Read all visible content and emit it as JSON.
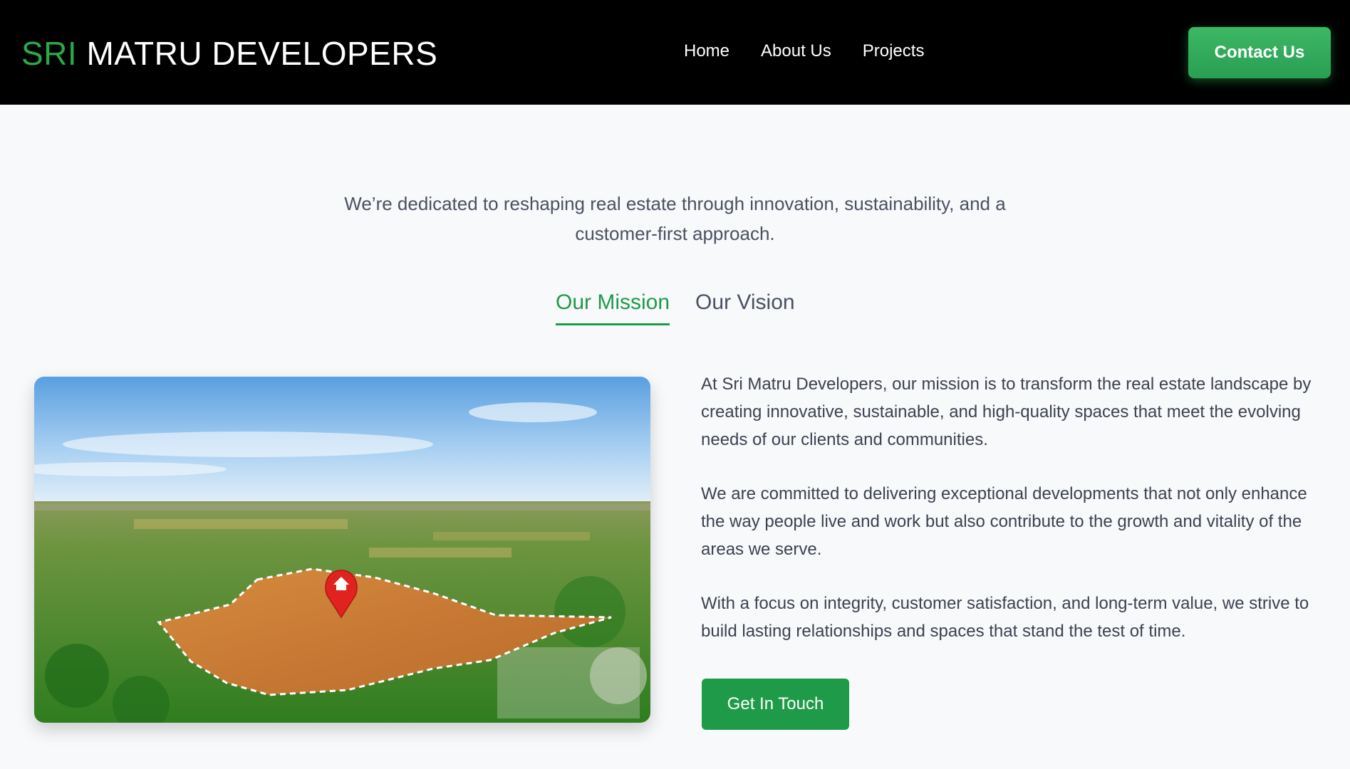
{
  "header": {
    "brand_accent": "SRI",
    "brand_rest": "MATRU DEVELOPERS",
    "nav": [
      "Home",
      "About Us",
      "Projects"
    ],
    "contact_label": "Contact Us"
  },
  "intro": {
    "text": "We’re dedicated to reshaping real estate through innovation, sustainability, and a customer-first approach."
  },
  "tabs": [
    {
      "label": "Our Mission",
      "active": true
    },
    {
      "label": "Our Vision",
      "active": false
    }
  ],
  "mission": {
    "image_icon": "location-pin-home-icon",
    "paragraphs": [
      "At Sri Matru Developers, our mission is to transform the real estate landscape by creating innovative, sustainable, and high-quality spaces that meet the evolving needs of our clients and communities.",
      "We are committed to delivering exceptional developments that not only enhance the way people live and work but also contribute to the growth and vitality of the areas we serve.",
      "With a focus on integrity, customer satisfaction, and long-term value, we strive to build lasting relationships and spaces that stand the test of time."
    ],
    "cta_label": "Get In Touch"
  },
  "colors": {
    "accent": "#1f9a48",
    "header_bg": "#000000",
    "page_bg": "#f8f9fb"
  }
}
